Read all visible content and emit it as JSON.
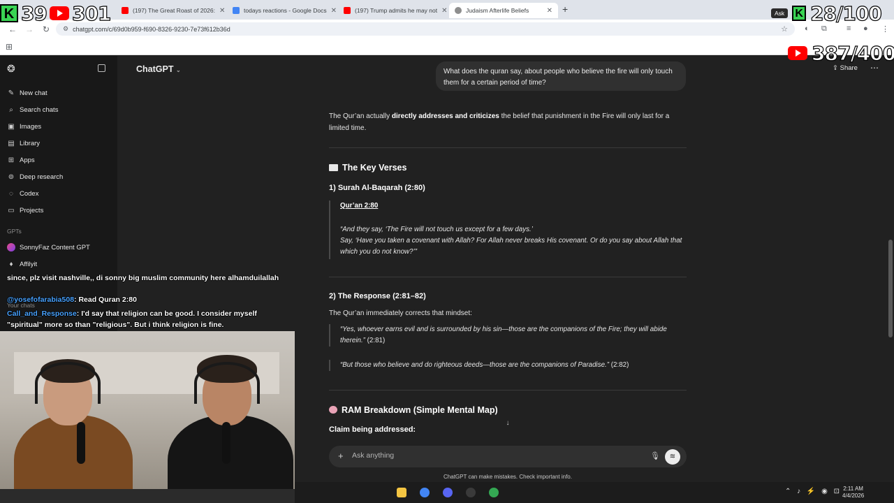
{
  "browser": {
    "tabs": [
      {
        "title": "",
        "active": false,
        "color": "#39d353"
      },
      {
        "title": "(197) The Great Roast of 2026:",
        "active": false,
        "color": "#ff0000"
      },
      {
        "title": "todays reactions - Google Docs",
        "active": false,
        "color": "#4285f4"
      },
      {
        "title": "(197) Trump admits he may not",
        "active": false,
        "color": "#ff0000"
      },
      {
        "title": "Judaism Afterlife Beliefs",
        "active": true,
        "color": "#8e8e8e"
      }
    ],
    "url": "chatgpt.com/c/69d0b959-f690-8326-9230-7e73f612b36d"
  },
  "sidebar": {
    "items": [
      {
        "label": "New chat",
        "icon": "edit-icon"
      },
      {
        "label": "Search chats",
        "icon": "search-icon"
      },
      {
        "label": "Images",
        "icon": "image-icon"
      },
      {
        "label": "Library",
        "icon": "library-icon"
      },
      {
        "label": "Apps",
        "icon": "apps-icon"
      },
      {
        "label": "Deep research",
        "icon": "telescope-icon"
      },
      {
        "label": "Codex",
        "icon": "codex-icon"
      },
      {
        "label": "Projects",
        "icon": "folder-icon"
      }
    ],
    "gpts_label": "GPTs",
    "gpts": [
      {
        "label": "SonnyFaz Content GPT"
      },
      {
        "label": "Affilyit"
      }
    ],
    "your_chats_label": "Your chats"
  },
  "header": {
    "model": "ChatGPT",
    "share": "Share"
  },
  "conversation": {
    "user_message": "What does the quran say, about people who believe the fire will only touch them for a certain period of time?",
    "intro_pre": "The Qur’an actually ",
    "intro_bold": "directly addresses and criticizes",
    "intro_post": " the belief that punishment in the Fire will only last for a limited time.",
    "section1_title": "The Key Verses",
    "sub1_title": "1) Surah Al-Baqarah (2:80)",
    "quote1_heading": "Qur’an 2:80",
    "quote1_line1": "“And they say, ‘The Fire will not touch us except for a few days.’",
    "quote1_line2": "Say, ‘Have you taken a covenant with Allah? For Allah never breaks His covenant. Or do you say about Allah that which you do not know?’”",
    "sub2_title": "2) The Response (2:81–82)",
    "response_intro": "The Qur’an immediately corrects that mindset:",
    "quote2_text": "“Yes, whoever earns evil and is surrounded by his sin—those are the companions of the Fire; they will abide therein.”",
    "quote2_ref": " (2:81)",
    "quote3_text": "“But those who believe and do righteous deeds—those are the companions of Paradise.”",
    "quote3_ref": " (2:82)",
    "section2_title": "RAM Breakdown (Simple Mental Map)",
    "claim_label": "Claim being addressed:"
  },
  "composer": {
    "placeholder": "Ask anything",
    "disclaimer": "ChatGPT can make mistakes. Check important info."
  },
  "taskbar": {
    "time": "2:11 AM",
    "date": "4/4/2026"
  },
  "overlay": {
    "kick_count": "39",
    "youtube_count": "301",
    "ask_label": "Ask",
    "goal1": "28/100",
    "goal2": "387/400",
    "chat": [
      {
        "user": "",
        "text": "since, plz visit nashville,, di sonny big muslim community here alhamduilallah"
      },
      {
        "user": "@yosefofarabia508",
        "text": ": Read Quran 2:80"
      },
      {
        "user": "Call_and_Response",
        "text": ": I'd say that religion can be good. I consider myself"
      },
      {
        "user": "",
        "text": "\"spiritual\" more so than \"religious\". But i think religion is fine."
      }
    ]
  }
}
